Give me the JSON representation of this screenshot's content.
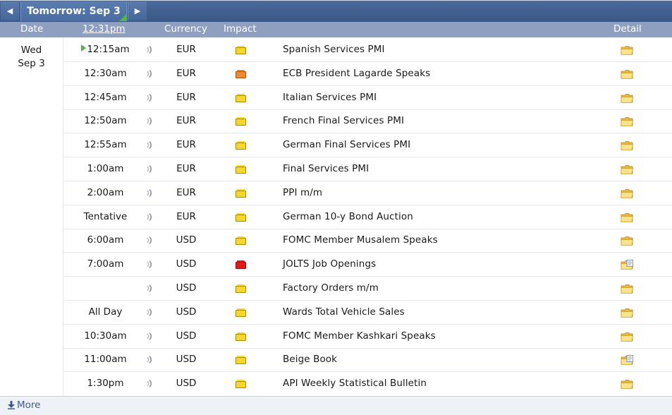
{
  "nav": {
    "day_label": "Tomorrow: Sep 3",
    "prev_glyph": "◀",
    "next_glyph": "▶"
  },
  "columns": {
    "date": "Date",
    "time": "12:31pm",
    "currency": "Currency",
    "impact": "Impact",
    "detail": "Detail"
  },
  "day": {
    "weekday": "Wed",
    "date": "Sep 3"
  },
  "impact_colors": {
    "low": "#f6d82c",
    "medium": "#f08a30",
    "high": "#e01a1a"
  },
  "events": [
    {
      "time": "12:15am",
      "next": true,
      "currency": "EUR",
      "impact": "low",
      "title": "Spanish Services PMI",
      "detail_icon": "folder-icon"
    },
    {
      "time": "12:30am",
      "currency": "EUR",
      "impact": "medium",
      "title": "ECB President Lagarde Speaks",
      "detail_icon": "folder-icon"
    },
    {
      "time": "12:45am",
      "currency": "EUR",
      "impact": "low",
      "title": "Italian Services PMI",
      "detail_icon": "folder-icon"
    },
    {
      "time": "12:50am",
      "currency": "EUR",
      "impact": "low",
      "title": "French Final Services PMI",
      "detail_icon": "folder-icon"
    },
    {
      "time": "12:55am",
      "currency": "EUR",
      "impact": "low",
      "title": "German Final Services PMI",
      "detail_icon": "folder-icon"
    },
    {
      "time": "1:00am",
      "currency": "EUR",
      "impact": "low",
      "title": "Final Services PMI",
      "detail_icon": "folder-icon"
    },
    {
      "time": "2:00am",
      "currency": "EUR",
      "impact": "low",
      "title": "PPI m/m",
      "detail_icon": "folder-icon"
    },
    {
      "time": "Tentative",
      "currency": "EUR",
      "impact": "low",
      "title": "German 10-y Bond Auction",
      "detail_icon": "folder-icon"
    },
    {
      "time": "6:00am",
      "currency": "USD",
      "impact": "low",
      "title": "FOMC Member Musalem Speaks",
      "detail_icon": "folder-icon"
    },
    {
      "time": "7:00am",
      "currency": "USD",
      "impact": "high",
      "title": "JOLTS Job Openings",
      "detail_icon": "folder-document-icon"
    },
    {
      "time": "",
      "currency": "USD",
      "impact": "low",
      "title": "Factory Orders m/m",
      "detail_icon": "folder-icon"
    },
    {
      "time": "All Day",
      "currency": "USD",
      "impact": "low",
      "title": "Wards Total Vehicle Sales",
      "detail_icon": "folder-icon"
    },
    {
      "time": "10:30am",
      "currency": "USD",
      "impact": "low",
      "title": "FOMC Member Kashkari Speaks",
      "detail_icon": "folder-icon"
    },
    {
      "time": "11:00am",
      "currency": "USD",
      "impact": "low",
      "title": "Beige Book",
      "detail_icon": "folder-document-icon"
    },
    {
      "time": "1:30pm",
      "currency": "USD",
      "impact": "low",
      "title": "API Weekly Statistical Bulletin",
      "detail_icon": "folder-icon"
    }
  ],
  "footer": {
    "more_label": "More",
    "more_icon": "download-arrow-icon"
  }
}
